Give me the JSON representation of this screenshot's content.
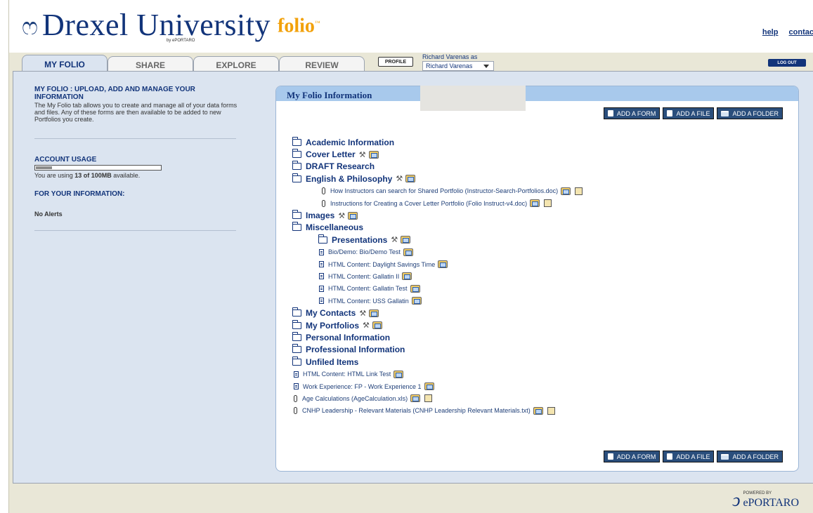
{
  "header": {
    "logo_name": "Drexel University",
    "logo_product": "folio",
    "logo_product_mark": "™",
    "logo_by": "by ePORTARO",
    "links": [
      "help",
      "contac"
    ]
  },
  "tabs": [
    {
      "label": "MY FOLIO",
      "active": true
    },
    {
      "label": "SHARE",
      "active": false
    },
    {
      "label": "EXPLORE",
      "active": false
    },
    {
      "label": "REVIEW",
      "active": false
    }
  ],
  "profile_button": "PROFILE",
  "user": {
    "as_label": "Richard Varenas as",
    "selected": "Richard Varenas"
  },
  "logout_button": "LOG OUT",
  "sidebar": {
    "title": "MY FOLIO : UPLOAD, ADD AND MANAGE YOUR INFORMATION",
    "description": "The My Folio tab allows you to create and manage all of your data forms and files. Any of these forms are then available to be added to new Portfolios you create.",
    "account_usage_title": "ACCOUNT USAGE",
    "usage_fraction": 0.13,
    "usage_prefix": "You are using ",
    "usage_amount": "13 of 100MB",
    "usage_suffix": " available.",
    "info_title": "FOR YOUR INFORMATION:",
    "alerts": "No Alerts"
  },
  "panel": {
    "title": "My Folio Information",
    "buttons": [
      "ADD A FORM",
      "ADD A FILE",
      "ADD A FOLDER"
    ],
    "tree": [
      {
        "type": "folder",
        "label": "Academic Information",
        "indent": 0
      },
      {
        "type": "folder",
        "label": "Cover Letter",
        "indent": 0,
        "tools": true,
        "share": true
      },
      {
        "type": "folder",
        "label": "DRAFT Research",
        "indent": 0
      },
      {
        "type": "folder-open",
        "label": "English & Philosophy",
        "indent": 0,
        "tools": true,
        "share": true
      },
      {
        "type": "file",
        "label": "How Instructors can search for Shared Portfolio (Instructor-Search-Portfolios.doc)",
        "indent": 1,
        "share": true,
        "download": true
      },
      {
        "type": "file",
        "label": "Instructions for Creating a Cover Letter Portfolio (Folio Instruct-v4.doc)",
        "indent": 1,
        "share": true,
        "download": true
      },
      {
        "type": "folder",
        "label": "Images",
        "indent": 0,
        "tools": true,
        "share": true
      },
      {
        "type": "folder-open",
        "label": "Miscellaneous",
        "indent": 0
      },
      {
        "type": "folder",
        "label": "Presentations",
        "indent": 1,
        "tools": true,
        "share": true
      },
      {
        "type": "form",
        "label": "Bio/Demo: Bio/Demo Test",
        "indent": 1,
        "share": true
      },
      {
        "type": "form",
        "label": "HTML Content: Daylight Savings Time",
        "indent": 1,
        "share": true
      },
      {
        "type": "form",
        "label": "HTML Content: Gallatin II",
        "indent": 1,
        "share": true
      },
      {
        "type": "form",
        "label": "HTML Content: Gallatin Test",
        "indent": 1,
        "share": true
      },
      {
        "type": "form",
        "label": "HTML Content: USS Gallatin",
        "indent": 1,
        "share": true
      },
      {
        "type": "folder",
        "label": "My Contacts",
        "indent": 0,
        "tools": true,
        "share": true
      },
      {
        "type": "folder",
        "label": "My Portfolios",
        "indent": 0,
        "tools": true,
        "share": true
      },
      {
        "type": "folder",
        "label": "Personal Information",
        "indent": 0
      },
      {
        "type": "folder",
        "label": "Professional Information",
        "indent": 0
      },
      {
        "type": "folder",
        "label": "Unfiled Items",
        "indent": 0
      },
      {
        "type": "form",
        "label": "HTML Content: HTML Link Test",
        "indent": 0,
        "share": true
      },
      {
        "type": "form",
        "label": "Work Experience: FP - Work Experience 1",
        "indent": 0,
        "share": true
      },
      {
        "type": "file",
        "label": "Age Calculations (AgeCalculation.xls)",
        "indent": 0,
        "share": true,
        "download": true
      },
      {
        "type": "file",
        "label": "CNHP Leadership - Relevant Materials (CNHP Leadership Relevant Materials.txt)",
        "indent": 0,
        "share": true,
        "download": true
      }
    ]
  },
  "footer": {
    "powered_by": "POWERED BY",
    "brand": "ePORTARO"
  }
}
